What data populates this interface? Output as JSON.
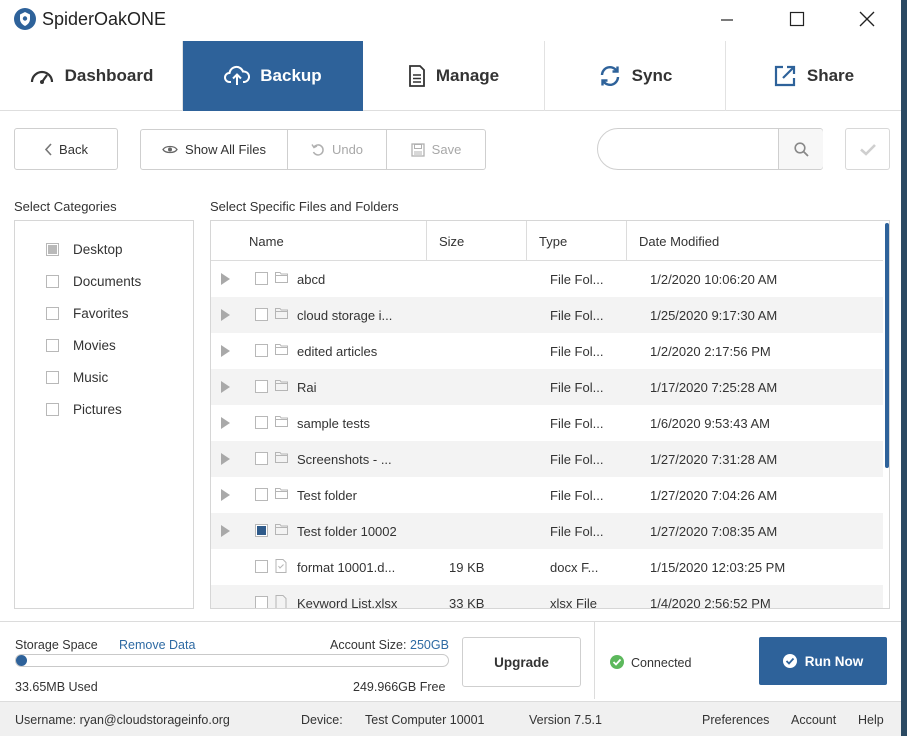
{
  "window": {
    "title": "SpiderOakONE",
    "minimize_icon": "minimize-icon",
    "maximize_icon": "maximize-icon",
    "close_icon": "close-icon"
  },
  "nav": {
    "tabs": [
      {
        "label": "Dashboard",
        "icon": "gauge-icon",
        "active": false
      },
      {
        "label": "Backup",
        "icon": "cloud-upload-icon",
        "active": true
      },
      {
        "label": "Manage",
        "icon": "document-icon",
        "active": false
      },
      {
        "label": "Sync",
        "icon": "sync-icon",
        "active": false
      },
      {
        "label": "Share",
        "icon": "share-icon",
        "active": false
      }
    ]
  },
  "toolbar": {
    "back_label": "Back",
    "show_all_label": "Show All Files",
    "undo_label": "Undo",
    "save_label": "Save",
    "search_value": "",
    "search_placeholder": ""
  },
  "categories": {
    "heading": "Select Categories",
    "items": [
      {
        "label": "Desktop",
        "state": "partial"
      },
      {
        "label": "Documents",
        "state": "unchecked"
      },
      {
        "label": "Favorites",
        "state": "unchecked"
      },
      {
        "label": "Movies",
        "state": "unchecked"
      },
      {
        "label": "Music",
        "state": "unchecked"
      },
      {
        "label": "Pictures",
        "state": "unchecked"
      }
    ]
  },
  "files": {
    "heading": "Select Specific Files and Folders",
    "columns": [
      "Name",
      "Size",
      "Type",
      "Date Modified"
    ],
    "rows": [
      {
        "name": "abcd",
        "size": "",
        "type": "File Fol...",
        "date": "1/2/2020 10:06:20 AM",
        "kind": "folder",
        "checked": false
      },
      {
        "name": "cloud storage i...",
        "size": "",
        "type": "File Fol...",
        "date": "1/25/2020 9:17:30 AM",
        "kind": "folder",
        "checked": false
      },
      {
        "name": "edited articles",
        "size": "",
        "type": "File Fol...",
        "date": "1/2/2020 2:17:56 PM",
        "kind": "folder",
        "checked": false
      },
      {
        "name": "Rai",
        "size": "",
        "type": "File Fol...",
        "date": "1/17/2020 7:25:28 AM",
        "kind": "folder",
        "checked": false
      },
      {
        "name": "sample tests",
        "size": "",
        "type": "File Fol...",
        "date": "1/6/2020 9:53:43 AM",
        "kind": "folder",
        "checked": false
      },
      {
        "name": "Screenshots - ...",
        "size": "",
        "type": "File Fol...",
        "date": "1/27/2020 7:31:28 AM",
        "kind": "folder",
        "checked": false
      },
      {
        "name": "Test folder",
        "size": "",
        "type": "File Fol...",
        "date": "1/27/2020 7:04:26 AM",
        "kind": "folder",
        "checked": false
      },
      {
        "name": "Test folder 10002",
        "size": "",
        "type": "File Fol...",
        "date": "1/27/2020 7:08:35 AM",
        "kind": "folder",
        "checked": true
      },
      {
        "name": "format 10001.d...",
        "size": "19 KB",
        "type": "docx F...",
        "date": "1/15/2020 12:03:25 PM",
        "kind": "file",
        "checked": false
      },
      {
        "name": "Keyword List.xlsx",
        "size": "33 KB",
        "type": "xlsx File",
        "date": "1/4/2020 2:56:52 PM",
        "kind": "file",
        "checked": false
      }
    ]
  },
  "storage": {
    "label": "Storage Space",
    "remove_label": "Remove Data",
    "account_size_label": "Account Size:",
    "account_size_value": "250GB",
    "used": "33.65MB Used",
    "free": "249.966GB Free",
    "used_fraction": 0.0001
  },
  "actions": {
    "upgrade_label": "Upgrade",
    "connected_label": "Connected",
    "run_now_label": "Run Now"
  },
  "status_bar": {
    "username": "Username: ryan@cloudstorageinfo.org",
    "device_label": "Device:",
    "device_value": "Test Computer 10001",
    "version": "Version 7.5.1",
    "preferences": "Preferences",
    "account": "Account",
    "help": "Help"
  },
  "colors": {
    "accent": "#2e629a",
    "connected": "#5cb85c",
    "link": "#2e6aa3"
  }
}
